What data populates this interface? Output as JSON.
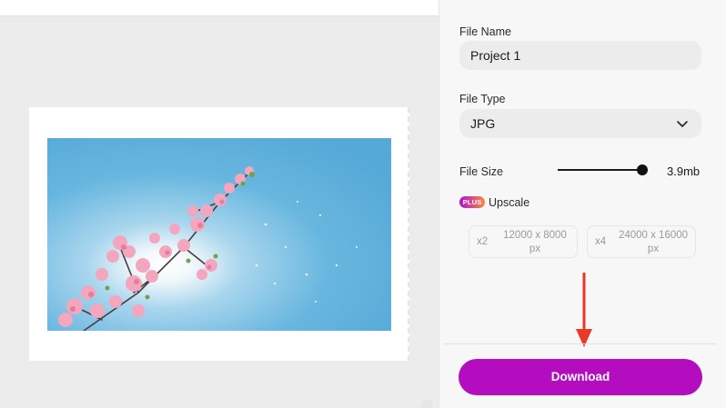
{
  "panel": {
    "file_name_label": "File Name",
    "file_name_value": "Project 1",
    "file_type_label": "File Type",
    "file_type_value": "JPG",
    "file_size_label": "File Size",
    "file_size_value": "3.9mb",
    "file_size_slider_fraction": 1.0,
    "plus_badge": "PLUS",
    "upscale_label": "Upscale",
    "upscale_options": [
      {
        "multiplier": "x2",
        "dimensions_line1": "12000 x 8000",
        "dimensions_line2": "px"
      },
      {
        "multiplier": "x4",
        "dimensions_line1": "24000 x 16000",
        "dimensions_line2": "px"
      }
    ],
    "download_label": "Download"
  },
  "icons": {
    "file_type_dropdown": "chevron-down-icon",
    "annotation": "red-down-arrow-icon"
  },
  "colors": {
    "download_button": "#b40cbf",
    "annotation_arrow": "#e8392b",
    "plus_badge_start": "#b10fd0",
    "plus_badge_end": "#ff8a3d"
  }
}
